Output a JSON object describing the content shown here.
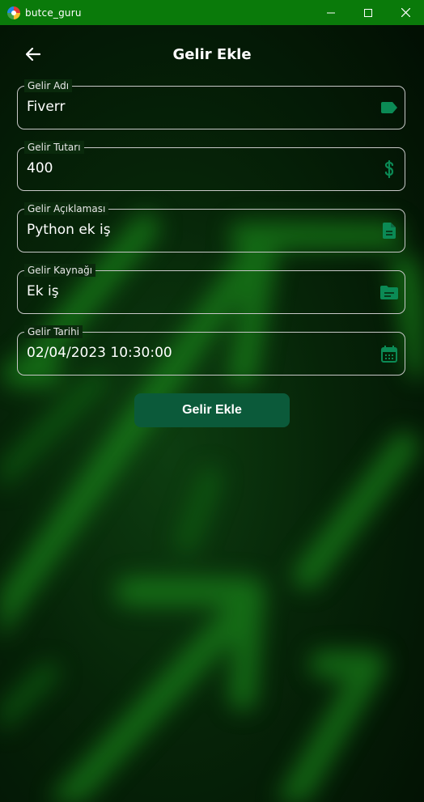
{
  "window": {
    "title": "butce_guru"
  },
  "header": {
    "title": "Gelir Ekle"
  },
  "form": {
    "fields": [
      {
        "label": "Gelir Adı",
        "value": "Fiverr",
        "icon": "label-icon"
      },
      {
        "label": "Gelir Tutarı",
        "value": "400",
        "icon": "dollar-icon"
      },
      {
        "label": "Gelir Açıklaması",
        "value": "Python ek iş",
        "icon": "document-icon"
      },
      {
        "label": "Gelir Kaynağı",
        "value": "Ek iş",
        "icon": "folder-icon"
      },
      {
        "label": "Gelir Tarihi",
        "value": "02/04/2023 10:30:00",
        "icon": "calendar-icon"
      }
    ],
    "submit_label": "Gelir Ekle"
  },
  "colors": {
    "titlebar": "#0a7a0a",
    "accent": "#0b8a55",
    "button": "#0b5a3a"
  }
}
